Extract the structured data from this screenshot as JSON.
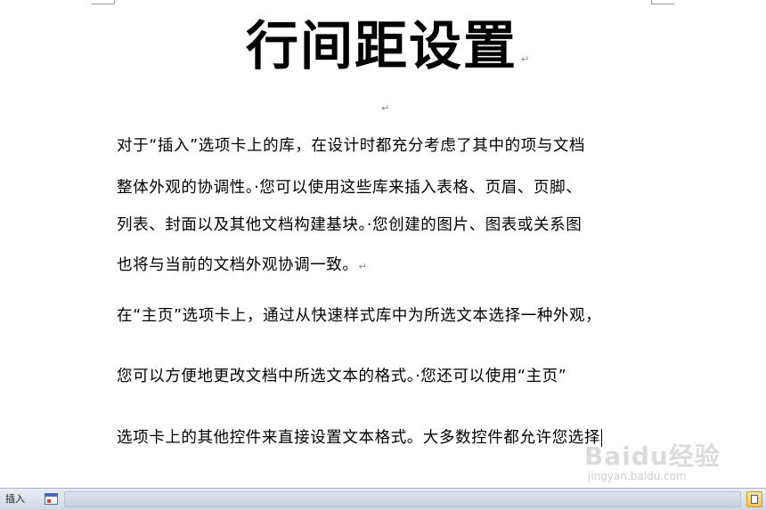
{
  "document": {
    "title": "行间距设置",
    "paragraph_mark": "↵",
    "lines": [
      "对于“插入”选项卡上的库，在设计时都充分考虑了其中的项与文档",
      "整体外观的协调性。·您可以使用这些库来插入表格、页眉、页脚、",
      "列表、封面以及其他文档构建基块。·您创建的图片、图表或关系图",
      "也将与当前的文档外观协调一致。",
      "在“主页”选项卡上，通过从快速样式库中为所选文本选择一种外观，",
      "您可以方便地更改文档中所选文本的格式。·您还可以使用“主页”",
      "选项卡上的其他控件来直接设置文本格式。大多数控件都允许您选择"
    ]
  },
  "watermark": {
    "logo": "Baidu经验",
    "url": "jingyan.baidu.com"
  },
  "status_bar": {
    "mode": "插入"
  },
  "icons": {
    "macro": "macro-record-icon",
    "view": "print-layout-view-icon"
  },
  "colors": {
    "status_bar": "#dfe5ee",
    "paragraph_mark": "#8a8a8a"
  }
}
